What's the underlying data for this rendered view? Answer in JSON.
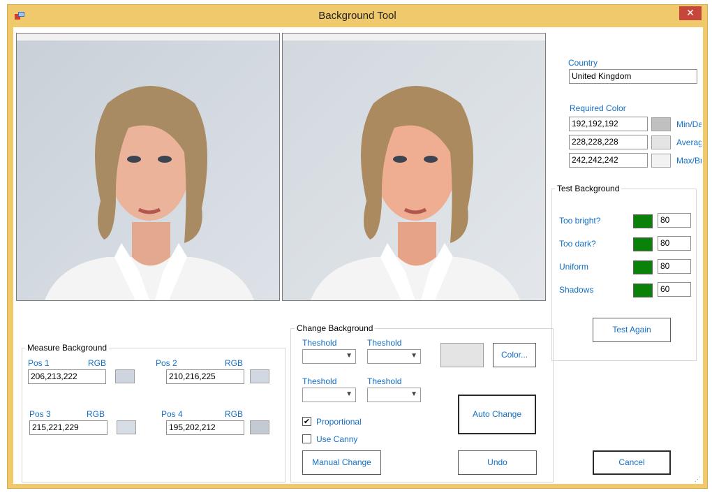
{
  "window": {
    "title": "Background Tool",
    "close_glyph": "✕",
    "app_icon": "app-icon"
  },
  "country": {
    "label": "Country",
    "value": "United Kingdom"
  },
  "required_color": {
    "label": "Required Color",
    "rows": [
      {
        "value": "192,192,192",
        "swatch": "#c0c0c0",
        "caption": "Min/Da"
      },
      {
        "value": "228,228,228",
        "swatch": "#e4e4e4",
        "caption": "Averag"
      },
      {
        "value": "242,242,242",
        "swatch": "#f2f2f2",
        "caption": "Max/Br"
      }
    ]
  },
  "test_background": {
    "title": "Test Background",
    "rows": [
      {
        "label": "Too bright?",
        "status_color": "#0a820a",
        "value": "80"
      },
      {
        "label": "Too dark?",
        "status_color": "#0a820a",
        "value": "80"
      },
      {
        "label": "Uniform",
        "status_color": "#0a820a",
        "value": "80"
      },
      {
        "label": "Shadows",
        "status_color": "#0a820a",
        "value": "60"
      }
    ],
    "test_again_label": "Test Again"
  },
  "measure_background": {
    "title": "Measure Background",
    "rgb_label": "RGB",
    "positions": [
      {
        "label": "Pos 1",
        "value": "206,213,222",
        "swatch": "#ced5de"
      },
      {
        "label": "Pos 2",
        "value": "210,216,225",
        "swatch": "#d2d8e1"
      },
      {
        "label": "Pos 3",
        "value": "215,221,229",
        "swatch": "#d7dde5"
      },
      {
        "label": "Pos 4",
        "value": "195,202,212",
        "swatch": "#c3cad4"
      }
    ]
  },
  "change_background": {
    "title": "Change Background",
    "threshold_label": "Theshold",
    "color_preview": "#e4e4e4",
    "color_button": "Color...",
    "proportional_label": "Proportional",
    "proportional_checked": true,
    "use_canny_label": "Use Canny",
    "use_canny_checked": false,
    "auto_change_label": "Auto Change",
    "manual_change_label": "Manual Change",
    "undo_label": "Undo"
  },
  "cancel_label": "Cancel",
  "check_glyph": "✔",
  "dropdown_glyph": "▼"
}
